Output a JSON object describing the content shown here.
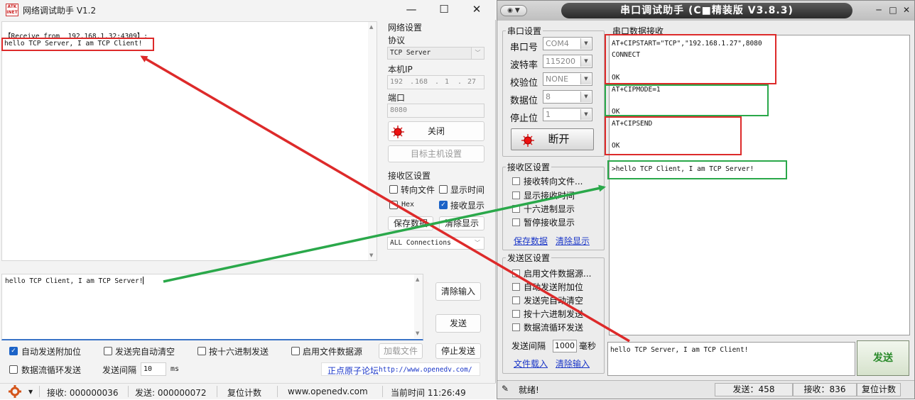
{
  "left": {
    "title": "网络调试助手 V1.2",
    "logo_text": "ATK INET",
    "window_buttons": [
      "—",
      "☐",
      "✕"
    ],
    "recv_lines": [
      "【Receive from  192.168.1.32:4309】:",
      "hello TCP Server, I am TCP Client!"
    ],
    "settings": {
      "header": "网络设置",
      "protocol_label": "协议",
      "protocol_value": "TCP Server",
      "ip_label": "本机IP",
      "ip_parts": [
        "192",
        "168",
        "1",
        "27"
      ],
      "port_label": "端口",
      "port_value": "8080",
      "close_button": "关闭",
      "target_button": "目标主机设置"
    },
    "recv_settings": {
      "header": "接收区设置",
      "redirect_file": "转向文件",
      "show_time": "显示时间",
      "hex": "Hex",
      "recv_display": "接收显示",
      "save_data": "保存数据",
      "clear_display": "清除显示",
      "connections": "ALL Connections"
    },
    "send_text": "hello TCP Client, I am TCP Server!",
    "clear_input": "清除输入",
    "send_button": "发送",
    "stop_send": "停止发送",
    "options": {
      "auto_append": "自动发送附加位",
      "auto_clear": "发送完自动清空",
      "hex_send": "按十六进制发送",
      "file_source": "启用文件数据源",
      "load_file": "加载文件",
      "loop_send": "数据流循环发送",
      "interval_label": "发送间隔",
      "interval_value": "10",
      "interval_unit": "ms",
      "forum_label": "正点原子论坛",
      "forum_url": "http://www.openedv.com/"
    },
    "status": {
      "recv": "接收: 000000036",
      "send": "发送: 000000072",
      "reset": "复位计数",
      "website": "www.openedv.com",
      "time": "当前时间 11:26:49"
    }
  },
  "right": {
    "title": "串口调试助手 (C■精装版 V3.8.3)",
    "sys_menu": "▼",
    "port_settings": {
      "header": "串口设置",
      "port_label": "串口号",
      "port_value": "COM4",
      "baud_label": "波特率",
      "baud_value": "115200",
      "parity_label": "校验位",
      "parity_value": "NONE",
      "data_label": "数据位",
      "data_value": "8",
      "stop_label": "停止位",
      "stop_value": "1",
      "disconnect": "断开"
    },
    "recv_settings": {
      "header": "接收区设置",
      "items": [
        "接收转向文件...",
        "显示接收时间",
        "十六进制显示",
        "暂停接收显示"
      ],
      "save_link": "保存数据",
      "clear_link": "清除显示"
    },
    "send_settings": {
      "header": "发送区设置",
      "items": [
        "启用文件数据源...",
        "自动发送附加位",
        "发送完自动清空",
        "按十六进制发送",
        "数据流循环发送"
      ],
      "interval_label": "发送间隔",
      "interval_value": "1000",
      "interval_unit": "毫秒",
      "file_link": "文件载入",
      "clear_link": "清除输入"
    },
    "recv_header": "串口数据接收",
    "recv_lines": [
      "AT+CIPSTART=\"TCP\",\"192.168.1.27\",8080",
      "CONNECT",
      "",
      "OK",
      "AT+CIPMODE=1",
      "",
      "OK",
      "AT+CIPSEND",
      "",
      "OK",
      ">hello TCP Client, I am TCP Server!"
    ],
    "send_text": "hello TCP Server, I am TCP Client!",
    "send_button": "发送",
    "status": {
      "ready": "就绪!",
      "send": "发送：458",
      "recv": "接收：836",
      "reset": "复位计数"
    }
  },
  "colors": {
    "red_annotation": "#dd2a2a",
    "green_annotation": "#2aa84a",
    "checkbox_blue": "#1c63c7",
    "link_blue": "#1a36c8"
  }
}
